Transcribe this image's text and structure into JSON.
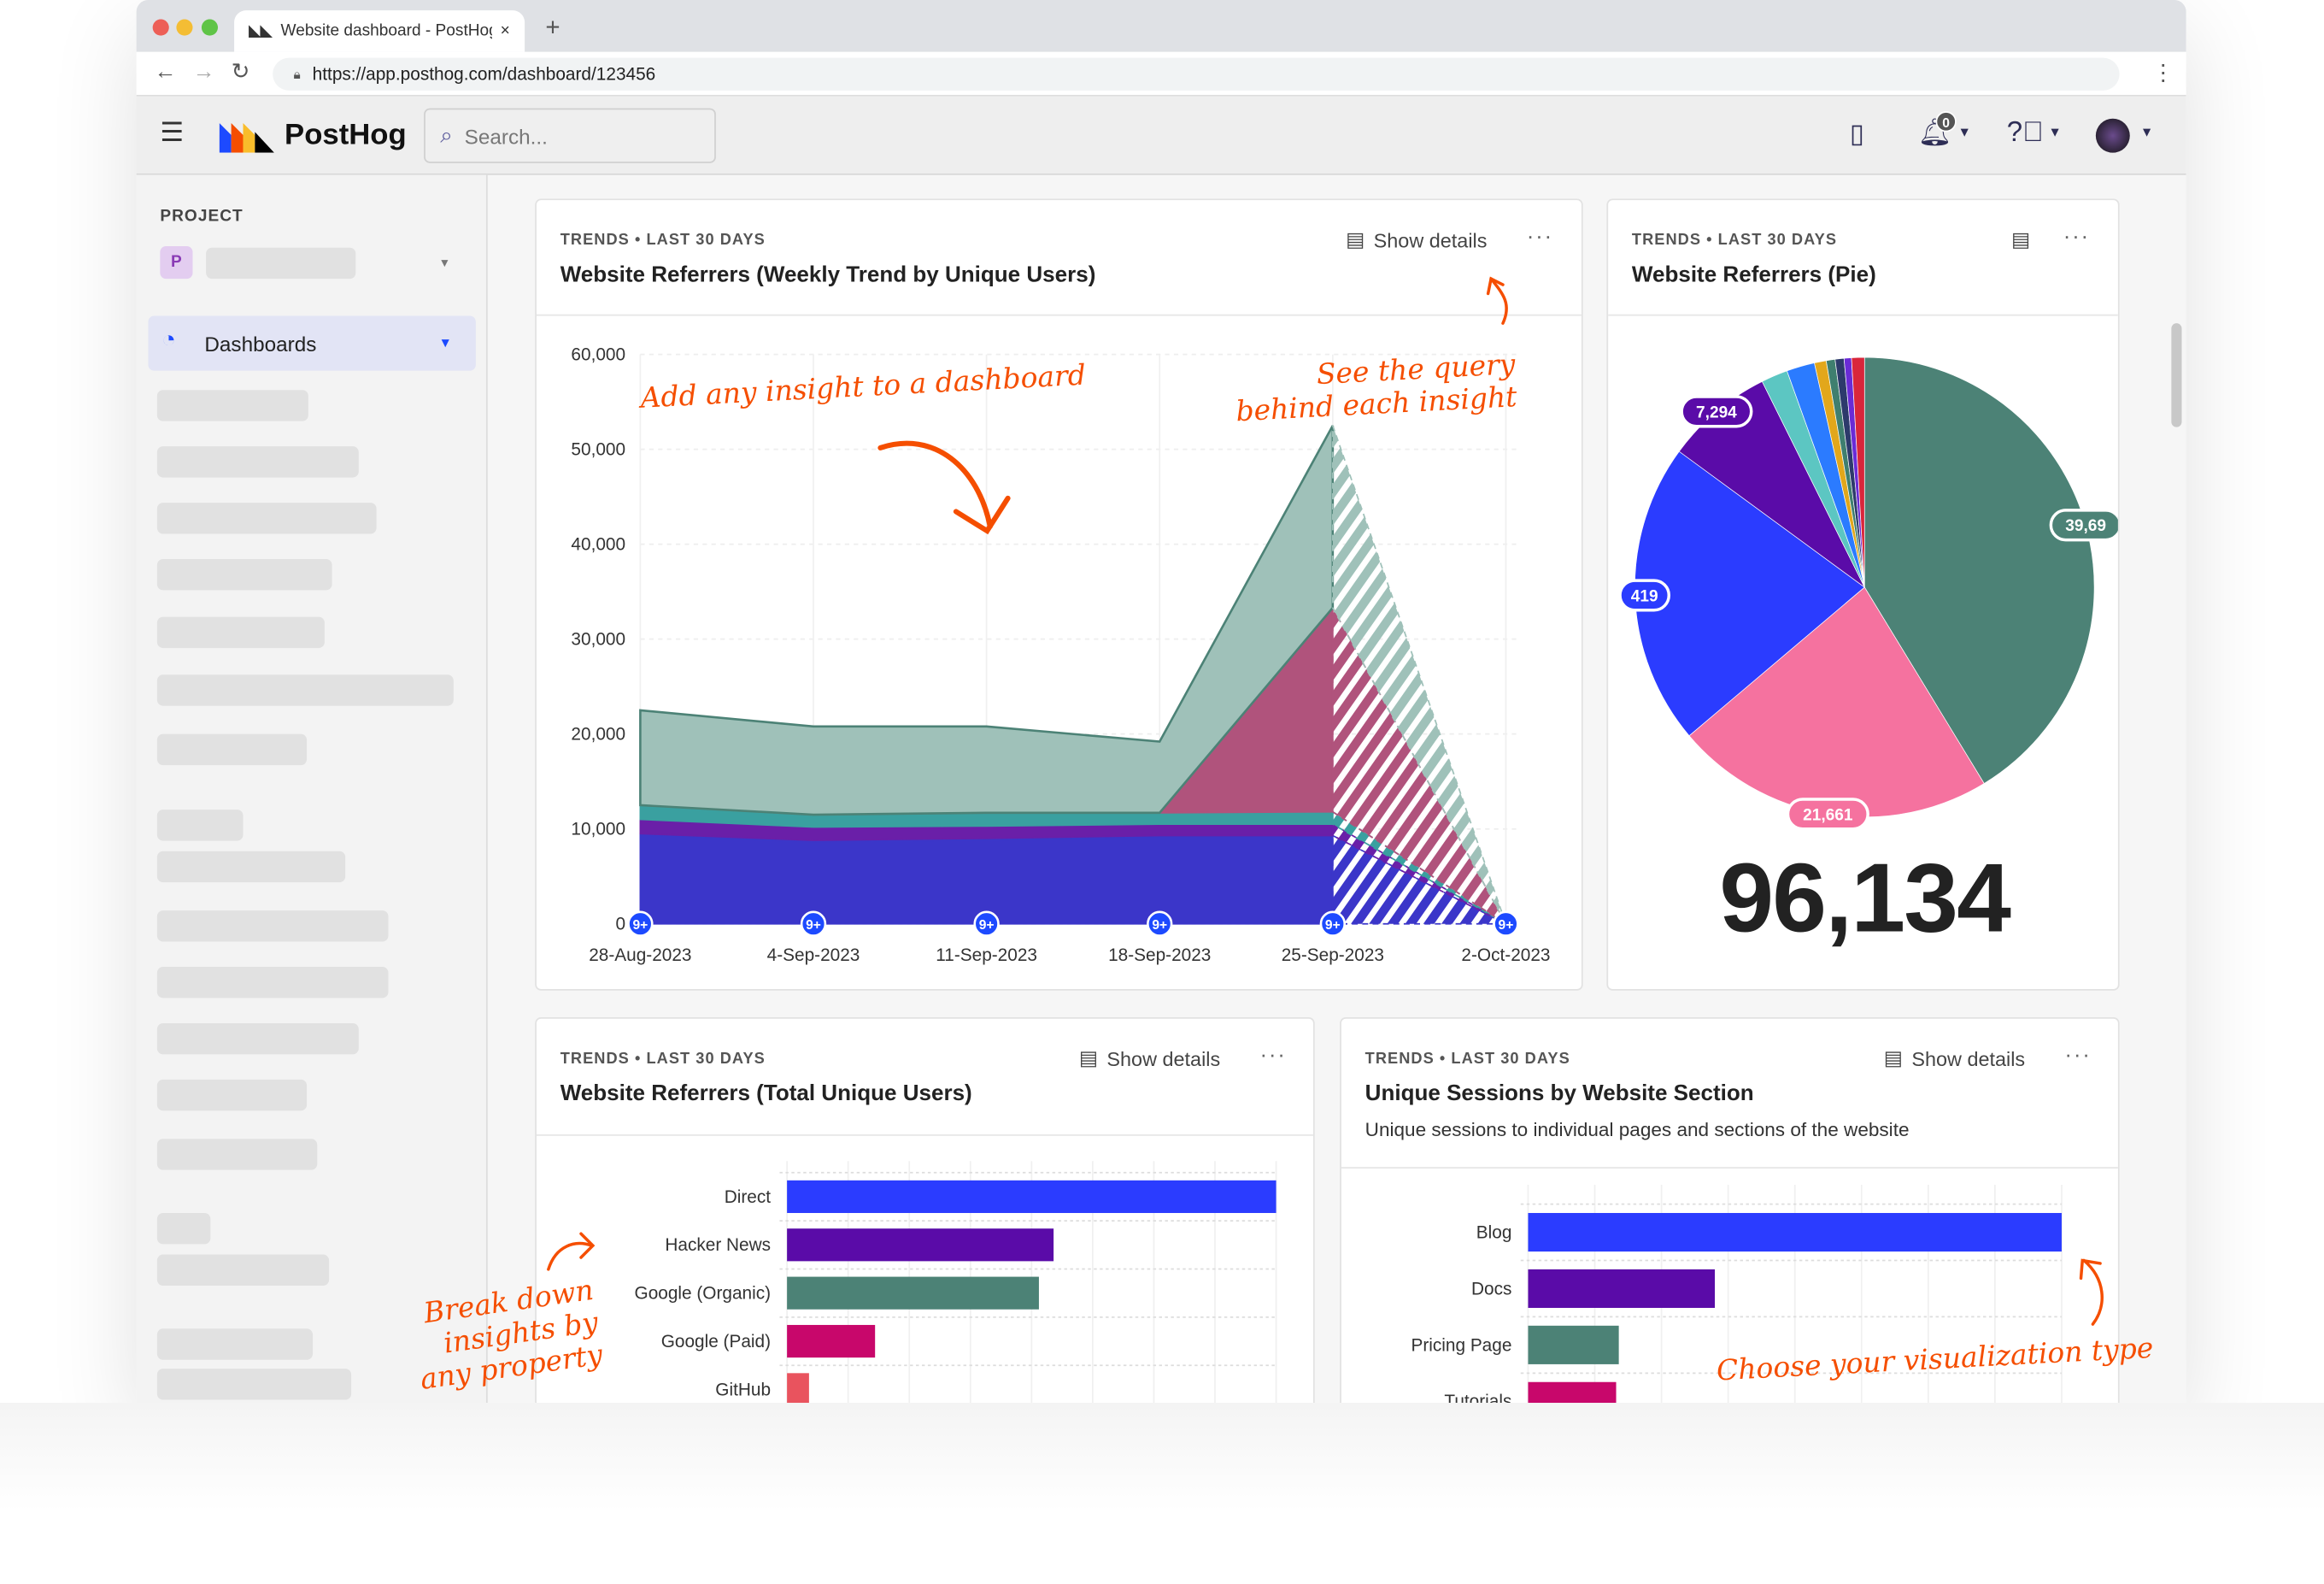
{
  "browser": {
    "tab_title": "Website dashboard - PostHog",
    "url": "https://app.posthog.com/dashboard/123456",
    "new_tab": "+",
    "close": "×"
  },
  "app": {
    "brand": "PostHog",
    "search_placeholder": "Search...",
    "notifications_count": "0"
  },
  "sidebar": {
    "project_label": "PROJECT",
    "project_avatar": "P",
    "dashboards_label": "Dashboards"
  },
  "colors": {
    "accent": "#f54e00",
    "blue": "#2b3cff",
    "purple": "#5a0ba8",
    "teal": "#4c8276",
    "pink": "#f5729f",
    "magenta": "#c8076b",
    "red": "#e9535e"
  },
  "cards": [
    {
      "tag": "TRENDS • LAST 30 DAYS",
      "title": "Website Referrers (Weekly Trend by Unique Users)",
      "details": "Show details",
      "more": "···"
    },
    {
      "tag": "TRENDS • LAST 30 DAYS",
      "title": "Website Referrers (Pie)",
      "more": "···",
      "total": "96,134"
    },
    {
      "tag": "TRENDS • LAST 30 DAYS",
      "title": "Website Referrers (Total Unique Users)",
      "details": "Show details",
      "more": "···"
    },
    {
      "tag": "TRENDS • LAST 30 DAYS",
      "title": "Unique Sessions by Website Section",
      "subtitle": "Unique sessions to individual pages and sections of the website",
      "details": "Show details",
      "more": "···"
    }
  ],
  "annotations": {
    "add_insight": "Add any insight to a dashboard",
    "see_query": "See the query behind each insight",
    "break_down": "Break down insights by any property",
    "choose_viz": "Choose your visualization type"
  },
  "chart_data": [
    {
      "type": "area",
      "stacked": true,
      "x": [
        "28-Aug-2023",
        "4-Sep-2023",
        "11-Sep-2023",
        "18-Sep-2023",
        "25-Sep-2023",
        "2-Oct-2023"
      ],
      "yticks": [
        "0",
        "10,000",
        "20,000",
        "30,000",
        "40,000",
        "50,000",
        "60,000"
      ],
      "ylim": [
        0,
        60000
      ],
      "grid": true,
      "marker_label": "9+",
      "series": [
        {
          "color": "#3b36c9",
          "values": [
            9500,
            8800,
            9000,
            9300,
            9300,
            0
          ]
        },
        {
          "color": "#6a1fa8",
          "values": [
            1500,
            1400,
            1300,
            1200,
            1200,
            0
          ]
        },
        {
          "color": "#3aa0a0",
          "values": [
            1500,
            1300,
            1400,
            1200,
            1300,
            0
          ]
        },
        {
          "color": "#b0537c",
          "values": [
            0,
            0,
            0,
            0,
            21500,
            0
          ]
        },
        {
          "color": "#9fc1b9",
          "values": [
            10000,
            9300,
            9100,
            7500,
            19200,
            0
          ]
        }
      ],
      "incomplete_last_period": true
    },
    {
      "type": "pie",
      "values": [
        39690,
        21661,
        20419,
        7294,
        1800,
        1900,
        800,
        600,
        600,
        500,
        870
      ],
      "labels": [
        "39,69",
        "21,661",
        "419",
        "7,294"
      ],
      "colors": [
        "#4c8276",
        "#f5729f",
        "#2b3cff",
        "#5a0ba8",
        "#5cc6c2",
        "#2b7bff",
        "#e2a71b",
        "#3f7f6f",
        "#2d3a6b",
        "#6a2bd6",
        "#d9263b"
      ]
    },
    {
      "type": "bar",
      "orientation": "horizontal",
      "categories": [
        "Direct",
        "Hacker News",
        "Google (Organic)",
        "Google (Paid)",
        "GitHub"
      ],
      "values": [
        100,
        54.5,
        51.5,
        18,
        4.5
      ],
      "colors": [
        "#2b3cff",
        "#5a0ba8",
        "#4c8276",
        "#c8076b",
        "#e9535e"
      ]
    },
    {
      "type": "bar",
      "orientation": "horizontal",
      "categories": [
        "Blog",
        "Docs",
        "Pricing Page",
        "Tutorials"
      ],
      "values": [
        100,
        35,
        17,
        16.5
      ],
      "colors": [
        "#2b3cff",
        "#5a0ba8",
        "#4c8276",
        "#c8076b"
      ]
    }
  ]
}
